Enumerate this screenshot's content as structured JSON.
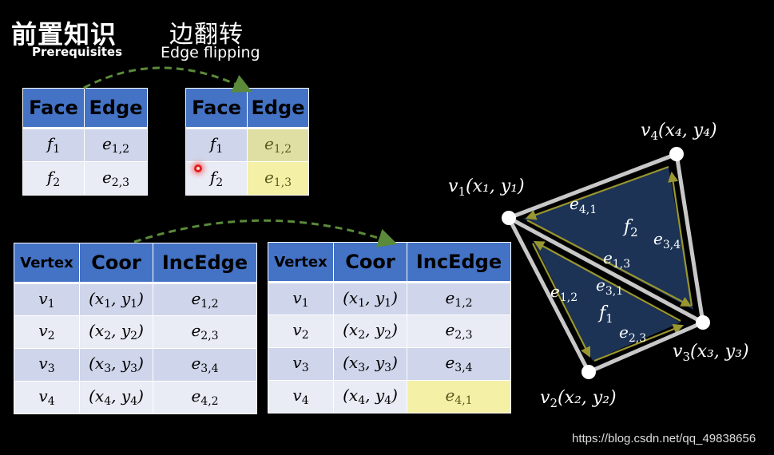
{
  "header": {
    "prereq_cn": "前置知识",
    "prereq_en": "Prerequisites",
    "topic_cn": "边翻转",
    "topic_en": "Edge flipping"
  },
  "face_table_before": {
    "headers": [
      "Face",
      "Edge"
    ],
    "rows": [
      {
        "face": "f",
        "face_sub": "1",
        "edge": "e",
        "edge_sub": "1,2"
      },
      {
        "face": "f",
        "face_sub": "2",
        "edge": "e",
        "edge_sub": "2,3"
      }
    ]
  },
  "face_table_after": {
    "headers": [
      "Face",
      "Edge"
    ],
    "rows": [
      {
        "face": "f",
        "face_sub": "1",
        "edge": "e",
        "edge_sub": "1,2",
        "highlight": true
      },
      {
        "face": "f",
        "face_sub": "2",
        "edge": "e",
        "edge_sub": "1,3",
        "highlight": true
      }
    ]
  },
  "vertex_table_before": {
    "headers": [
      "Vertex",
      "Coor",
      "IncEdge"
    ],
    "rows": [
      {
        "v": "v",
        "v_sub": "1",
        "x_sub": "1",
        "y_sub": "1",
        "e": "e",
        "e_sub": "1,2"
      },
      {
        "v": "v",
        "v_sub": "2",
        "x_sub": "2",
        "y_sub": "2",
        "e": "e",
        "e_sub": "2,3"
      },
      {
        "v": "v",
        "v_sub": "3",
        "x_sub": "3",
        "y_sub": "3",
        "e": "e",
        "e_sub": "3,4"
      },
      {
        "v": "v",
        "v_sub": "4",
        "x_sub": "4",
        "y_sub": "4",
        "e": "e",
        "e_sub": "4,2"
      }
    ]
  },
  "vertex_table_after": {
    "headers": [
      "Vertex",
      "Coor",
      "IncEdge"
    ],
    "rows": [
      {
        "v": "v",
        "v_sub": "1",
        "x_sub": "1",
        "y_sub": "1",
        "e": "e",
        "e_sub": "1,2"
      },
      {
        "v": "v",
        "v_sub": "2",
        "x_sub": "2",
        "y_sub": "2",
        "e": "e",
        "e_sub": "2,3"
      },
      {
        "v": "v",
        "v_sub": "3",
        "x_sub": "3",
        "y_sub": "3",
        "e": "e",
        "e_sub": "3,4"
      },
      {
        "v": "v",
        "v_sub": "4",
        "x_sub": "4",
        "y_sub": "4",
        "e": "e",
        "e_sub": "4,1",
        "highlight": true
      }
    ]
  },
  "mesh": {
    "vertices": [
      {
        "name": "v",
        "sub": "1",
        "label": "(x₁, y₁)"
      },
      {
        "name": "v",
        "sub": "2",
        "label": "(x₂, y₂)"
      },
      {
        "name": "v",
        "sub": "3",
        "label": "(x₃, y₃)"
      },
      {
        "name": "v",
        "sub": "4",
        "label": "(x₄, y₄)"
      }
    ],
    "faces": [
      {
        "name": "f",
        "sub": "1"
      },
      {
        "name": "f",
        "sub": "2"
      }
    ],
    "half_edges": [
      {
        "name": "e",
        "sub": "4,1"
      },
      {
        "name": "e",
        "sub": "3,4"
      },
      {
        "name": "e",
        "sub": "1,3"
      },
      {
        "name": "e",
        "sub": "3,1"
      },
      {
        "name": "e",
        "sub": "1,2"
      },
      {
        "name": "e",
        "sub": "2,3"
      }
    ]
  },
  "colors": {
    "header_blue": "#4472c4",
    "row_odd": "#cfd5ea",
    "row_even": "#e9ebf5",
    "highlight_yellow": "#f4f0a6",
    "arrow_green": "#5b8a3a",
    "face_fill": "#1c3356",
    "half_edge": "#7b7a1e"
  },
  "watermark": "https://blog.csdn.net/qq_49838656"
}
